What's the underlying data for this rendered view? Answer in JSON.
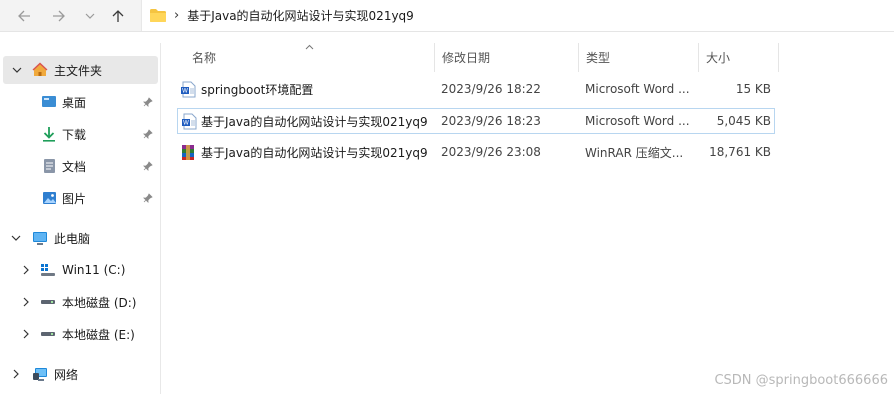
{
  "address_bar": {
    "breadcrumb": "基于Java的自动化网站设计与实现021yq9",
    "separator": "›"
  },
  "sidebar": {
    "home": {
      "label": "主文件夹",
      "icon": "home-icon"
    },
    "quick_access": [
      {
        "label": "桌面",
        "icon": "desktop-icon",
        "pinned": true
      },
      {
        "label": "下载",
        "icon": "download-icon",
        "pinned": true
      },
      {
        "label": "文档",
        "icon": "document-icon",
        "pinned": true
      },
      {
        "label": "图片",
        "icon": "picture-icon",
        "pinned": true
      }
    ],
    "this_pc": {
      "label": "此电脑",
      "icon": "computer-icon"
    },
    "drives": [
      {
        "label": "Win11 (C:)",
        "icon": "windows-drive-icon"
      },
      {
        "label": "本地磁盘 (D:)",
        "icon": "drive-icon"
      },
      {
        "label": "本地磁盘 (E:)",
        "icon": "drive-icon"
      }
    ],
    "network": {
      "label": "网络",
      "icon": "network-icon"
    }
  },
  "columns": {
    "name": "名称",
    "date": "修改日期",
    "type": "类型",
    "size": "大小"
  },
  "files": [
    {
      "name": "springboot环境配置",
      "date": "2023/9/26 18:22",
      "type": "Microsoft Word ...",
      "size": "15 KB",
      "icon": "word-doc-icon"
    },
    {
      "name": "基于Java的自动化网站设计与实现021yq9",
      "date": "2023/9/26 18:23",
      "type": "Microsoft Word ...",
      "size": "5,045 KB",
      "icon": "word-doc-icon"
    },
    {
      "name": "基于Java的自动化网站设计与实现021yq9",
      "date": "2023/9/26 23:08",
      "type": "WinRAR 压缩文...",
      "size": "18,761 KB",
      "icon": "winrar-archive-icon"
    }
  ],
  "watermark": "CSDN @springboot666666",
  "colors": {
    "accent": "#0067c0",
    "selection_border": "#b8d6f0",
    "sidebar_selected": "#e8e8e8"
  }
}
